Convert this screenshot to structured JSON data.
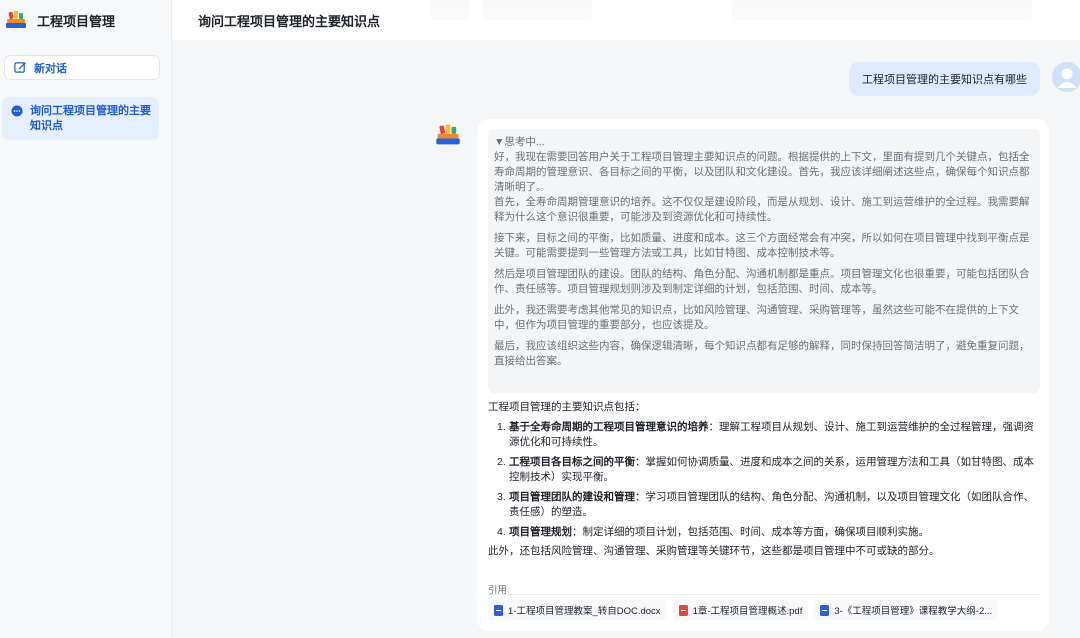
{
  "app": {
    "title": "工程项目管理",
    "new_chat_label": "新对话",
    "logo": "books-icon"
  },
  "sidebar": {
    "conversations": [
      {
        "label": "询问工程项目管理的主要知识点",
        "icon": "chat-bubble-icon",
        "active": true
      }
    ]
  },
  "header": {
    "title": "询问工程项目管理的主要知识点"
  },
  "user_message": {
    "text": "工程项目管理的主要知识点有哪些"
  },
  "assistant": {
    "thinking_label": "▼思考中...",
    "thinking_paragraphs": [
      "好，我现在需要回答用户关于工程项目管理主要知识点的问题。根据提供的上下文，里面有提到几个关键点，包括全寿命周期的管理意识、各目标之间的平衡，以及团队和文化建设。首先，我应该详细阐述这些点，确保每个知识点都清晰明了。",
      "首先，全寿命周期管理意识的培养。这不仅仅是建设阶段，而是从规划、设计、施工到运营维护的全过程。我需要解释为什么这个意识很重要，可能涉及到资源优化和可持续性。",
      "接下来，目标之间的平衡，比如质量、进度和成本。这三个方面经常会有冲突，所以如何在项目管理中找到平衡点是关键。可能需要提到一些管理方法或工具，比如甘特图、成本控制技术等。",
      "然后是项目管理团队的建设。团队的结构、角色分配、沟通机制都是重点。项目管理文化也很重要，可能包括团队合作、责任感等。项目管理规划则涉及到制定详细的计划，包括范围、时间、成本等。",
      "此外，我还需要考虑其他常见的知识点，比如风险管理、沟通管理、采购管理等，虽然这些可能不在提供的上下文中，但作为项目管理的重要部分，也应该提及。",
      "最后，我应该组织这些内容，确保逻辑清晰，每个知识点都有足够的解释，同时保持回答简洁明了，避免重复问题，直接给出答案。"
    ],
    "answer_intro": "工程项目管理的主要知识点包括：",
    "answer_items": [
      {
        "num": "1.",
        "title": "基于全寿命周期的工程项目管理意识的培养",
        "text": "：理解工程项目从规划、设计、施工到运营维护的全过程管理，强调资源优化和可持续性。"
      },
      {
        "num": "2.",
        "title": "工程项目各目标之间的平衡",
        "text": "：掌握如何协调质量、进度和成本之间的关系，运用管理方法和工具（如甘特图、成本控制技术）实现平衡。"
      },
      {
        "num": "3.",
        "title": "项目管理团队的建设和管理",
        "text": "：学习项目管理团队的结构、角色分配、沟通机制，以及项目管理文化（如团队合作、责任感）的塑造。"
      },
      {
        "num": "4.",
        "title": "项目管理规划",
        "text": "：制定详细的项目计划，包括范围、时间、成本等方面，确保项目顺利实施。"
      }
    ],
    "answer_outro": "此外，还包括风险管理、沟通管理、采购管理等关键环节，这些都是项目管理中不可或缺的部分。",
    "citations_title": "引用",
    "citations": [
      {
        "label": "1-工程项目管理教案_转自DOC.docx",
        "type": "doc"
      },
      {
        "label": "1章-工程项目管理概述.pdf",
        "type": "pdf"
      },
      {
        "label": "3-《工程项目管理》课程教学大纲-2...",
        "type": "doc"
      }
    ]
  },
  "colors": {
    "accent": "#1f5fd1",
    "user_bubble": "#dfeafe",
    "sidebar_active": "#e6efff"
  }
}
